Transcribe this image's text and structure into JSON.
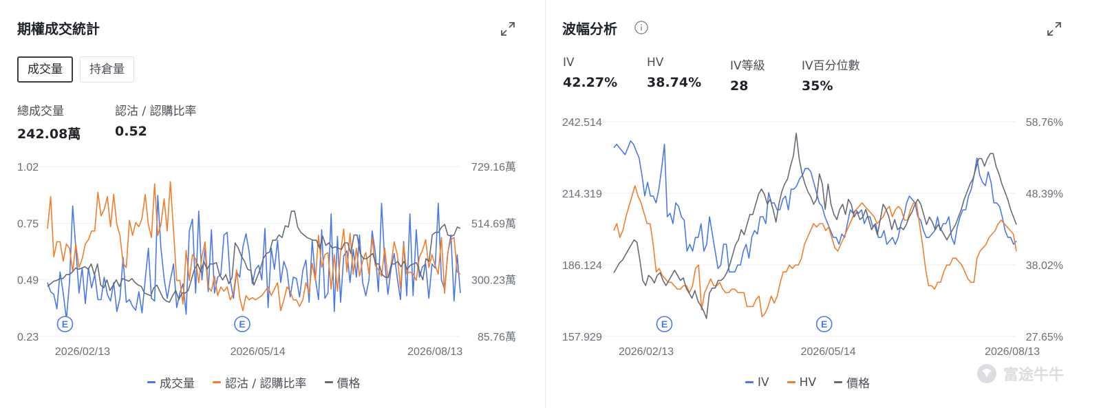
{
  "colors": {
    "blue": "#4a78e8",
    "orange": "#f07e2c",
    "gray": "#656a75"
  },
  "left": {
    "title": "期權成交統計",
    "tabs": [
      {
        "label": "成交量",
        "active": true
      },
      {
        "label": "持倉量",
        "active": false
      }
    ],
    "stats": [
      {
        "label": "總成交量",
        "value": "242.08萬"
      },
      {
        "label": "認沽 / 認購比率",
        "value": "0.52"
      }
    ],
    "legend": [
      "成交量",
      "認沽 / 認購比率",
      "價格"
    ],
    "earnings_marker": "E"
  },
  "right": {
    "title": "波幅分析",
    "stats": [
      {
        "label": "IV",
        "value": "42.27%"
      },
      {
        "label": "HV",
        "value": "38.74%"
      },
      {
        "label": "IV等級",
        "value": "28"
      },
      {
        "label": "IV百分位數",
        "value": "35%"
      }
    ],
    "legend": [
      "IV",
      "HV",
      "價格"
    ],
    "earnings_marker": "E"
  },
  "watermark": "富途牛牛",
  "chart_data": [
    {
      "type": "line",
      "x_range": [
        "2026-01-26",
        "2026-08-26"
      ],
      "x_ticks": [
        {
          "label": "2026/02/13",
          "date": "2026-02-13"
        },
        {
          "label": "2026/05/14",
          "date": "2026-05-14"
        },
        {
          "label": "2026/08/13",
          "date": "2026-08-13"
        }
      ],
      "y_left": {
        "ticks": [
          "1.02",
          "0.75",
          "0.49",
          "0.23"
        ],
        "range": [
          0.23,
          1.02
        ]
      },
      "y_right": {
        "ticks": [
          "729.16萬",
          "514.69萬",
          "300.23萬",
          "85.76萬"
        ],
        "range": [
          85.76,
          729.16
        ],
        "unit": "萬"
      },
      "earnings_dates": [
        "2026-02-04",
        "2026-05-06"
      ],
      "series": [
        {
          "name": "成交量",
          "axis": "right",
          "color": "#4a78e8",
          "values": [
            290,
            255,
            245,
            190,
            330,
            250,
            150,
            295,
            580,
            420,
            250,
            345,
            210,
            345,
            270,
            320,
            225,
            225,
            310,
            245,
            220,
            290,
            180,
            230,
            385,
            215,
            225,
            200,
            185,
            255,
            175,
            300,
            420,
            230,
            220,
            620,
            420,
            305,
            230,
            300,
            360,
            195,
            250,
            285,
            170,
            485,
            530,
            250,
            560,
            300,
            420,
            255,
            490,
            250,
            310,
            320,
            470,
            480,
            300,
            230,
            330,
            310,
            425,
            475,
            405,
            285,
            340,
            355,
            300,
            495,
            195,
            420,
            340,
            450,
            290,
            370,
            335,
            235,
            310,
            305,
            235,
            335,
            375,
            215,
            450,
            305,
            225,
            490,
            230,
            250,
            550,
            180,
            465,
            215,
            390,
            410,
            290,
            415,
            310,
            470,
            290,
            240,
            300,
            485,
            405,
            255,
            590,
            370,
            245,
            340,
            400,
            305,
            225,
            445,
            240,
            550,
            240,
            490,
            310,
            350,
            360,
            230,
            360,
            345,
            590,
            300,
            265,
            400,
            470,
            220,
            395,
            250
          ]
        },
        {
          "name": "認沽 / 認購比率",
          "axis": "left",
          "color": "#f07e2c",
          "values": [
            0.73,
            0.88,
            0.6,
            0.67,
            0.67,
            0.58,
            0.66,
            0.64,
            0.53,
            0.66,
            0.55,
            0.59,
            0.66,
            0.68,
            0.72,
            0.72,
            0.9,
            0.79,
            0.82,
            0.88,
            0.74,
            0.89,
            0.75,
            0.7,
            0.57,
            0.55,
            0.77,
            0.7,
            0.76,
            0.74,
            0.78,
            0.89,
            0.75,
            0.69,
            0.94,
            0.7,
            0.75,
            0.87,
            0.72,
            0.95,
            0.72,
            0.49,
            0.49,
            0.38,
            0.63,
            0.49,
            0.61,
            0.59,
            0.48,
            0.6,
            0.67,
            0.46,
            0.44,
            0.51,
            0.42,
            0.46,
            0.44,
            0.46,
            0.4,
            0.43,
            0.54,
            0.41,
            0.35,
            0.42,
            0.4,
            0.41,
            0.4,
            0.41,
            0.42,
            0.44,
            0.46,
            0.42,
            0.45,
            0.48,
            0.35,
            0.4,
            0.46,
            0.44,
            0.4,
            0.4,
            0.37,
            0.4,
            0.48,
            0.43,
            0.57,
            0.49,
            0.7,
            0.55,
            0.61,
            0.62,
            0.45,
            0.61,
            0.44,
            0.62,
            0.73,
            0.53,
            0.71,
            0.52,
            0.64,
            0.51,
            0.58,
            0.62,
            0.52,
            0.69,
            0.56,
            0.54,
            0.51,
            0.64,
            0.5,
            0.56,
            0.67,
            0.61,
            0.45,
            0.66,
            0.52,
            0.53,
            0.52,
            0.49,
            0.6,
            0.63,
            0.68,
            0.55,
            0.61,
            0.56,
            0.52,
            0.69,
            0.43,
            0.62,
            0.68,
            0.69,
            0.53,
            0.52
          ]
        },
        {
          "name": "價格",
          "axis": "right",
          "color": "#656a75",
          "values": [
            275,
            285,
            295,
            298,
            305,
            305,
            320,
            320,
            330,
            345,
            340,
            345,
            350,
            340,
            360,
            320,
            360,
            280,
            270,
            300,
            260,
            280,
            300,
            275,
            305,
            300,
            295,
            305,
            290,
            280,
            275,
            250,
            245,
            240,
            270,
            280,
            255,
            230,
            220,
            215,
            240,
            260,
            225,
            250,
            250,
            260,
            300,
            340,
            360,
            330,
            370,
            340,
            360,
            360,
            365,
            320,
            300,
            320,
            285,
            310,
            440,
            420,
            390,
            370,
            340,
            335,
            280,
            310,
            340,
            380,
            400,
            405,
            450,
            450,
            470,
            460,
            505,
            500,
            560,
            560,
            500,
            480,
            470,
            460,
            455,
            450,
            450,
            420,
            465,
            430,
            440,
            420,
            425,
            420,
            415,
            440,
            440,
            400,
            470,
            470,
            400,
            380,
            380,
            390,
            400,
            360,
            360,
            320,
            310,
            310,
            360,
            360,
            370,
            350,
            370,
            340,
            355,
            360,
            365,
            330,
            300,
            380,
            370,
            470,
            480,
            480,
            500,
            510,
            470,
            465,
            470,
            500,
            495
          ]
        }
      ]
    },
    {
      "type": "line",
      "x_range": [
        "2026-01-28",
        "2026-08-15"
      ],
      "x_ticks": [
        {
          "label": "2026/02/13",
          "date": "2026-02-13"
        },
        {
          "label": "2026/05/14",
          "date": "2026-05-14"
        },
        {
          "label": "2026/08/13",
          "date": "2026-08-13"
        }
      ],
      "y_left": {
        "ticks": [
          "242.514",
          "214.319",
          "186.124",
          "157.929"
        ],
        "range": [
          157.929,
          242.514
        ]
      },
      "y_right": {
        "ticks": [
          "58.76%",
          "48.39%",
          "38.02%",
          "27.65%"
        ],
        "range": [
          27.65,
          58.76
        ],
        "unit": "%"
      },
      "earnings_dates": [
        "2026-02-22",
        "2026-05-12"
      ],
      "series": [
        {
          "name": "IV",
          "axis": "right",
          "color": "#4a78e8",
          "values": [
            55.0,
            55.5,
            55.0,
            54.5,
            54.0,
            55.0,
            56.0,
            55.5,
            54.5,
            53.5,
            51.0,
            48.0,
            50.0,
            48.0,
            48.0,
            47.0,
            49.0,
            52.0,
            55.5,
            45.0,
            45.5,
            44.0,
            47.0,
            46.5,
            45.0,
            44.5,
            40.0,
            41.0,
            40.0,
            42.0,
            42.0,
            44.0,
            40.0,
            41.0,
            45.0,
            42.5,
            40.0,
            37.5,
            38.0,
            41.0,
            41.0,
            37.0,
            37.0,
            37.0,
            38.0,
            38.0,
            40.0,
            41.0,
            39.0,
            42.0,
            43.0,
            42.5,
            45.0,
            45.0,
            44.0,
            48.5,
            47.0,
            47.0,
            46.0,
            46.0,
            47.5,
            48.0,
            46.0,
            49.0,
            49.0,
            49.5,
            50.5,
            51.0,
            52.0,
            52.0,
            51.5,
            50.0,
            48.5,
            47.0,
            46.5,
            45.0,
            44.0,
            43.0,
            42.0,
            42.0,
            41.0,
            42.5,
            42.0,
            44.0,
            46.0,
            45.5,
            46.0,
            45.5,
            46.0,
            44.0,
            45.0,
            45.0,
            43.5,
            44.0,
            42.0,
            42.0,
            43.0,
            41.0,
            41.5,
            42.0,
            41.0,
            42.0,
            44.0,
            45.0,
            47.0,
            48.0,
            47.5,
            47.0,
            45.0,
            44.5,
            43.0,
            42.0,
            42.0,
            42.5,
            43.0,
            45.0,
            43.0,
            44.0,
            44.0,
            45.0,
            42.0,
            41.0,
            43.5,
            45.0,
            46.0,
            46.0,
            48.0,
            49.0,
            51.0,
            53.5,
            51.0,
            50.0,
            49.5,
            51.5,
            50.0,
            47.0,
            47.0,
            46.5,
            45.0,
            43.0,
            42.0,
            42.0,
            41.0,
            41.5
          ]
        },
        {
          "name": "HV",
          "axis": "right",
          "color": "#f07e2c",
          "values": [
            43.0,
            44.0,
            42.0,
            43.0,
            45.0,
            46.5,
            48.0,
            49.5,
            48.0,
            47.0,
            45.5,
            44.0,
            44.0,
            41.0,
            37.0,
            37.5,
            36.5,
            36.0,
            35.5,
            35.5,
            35.0,
            34.5,
            34.5,
            35.0,
            35.0,
            34.0,
            35.0,
            37.5,
            38.0,
            31.5,
            34.0,
            35.0,
            36.0,
            35.0,
            35.0,
            35.5,
            34.5,
            34.0,
            34.0,
            34.5,
            34.5,
            34.0,
            34.0,
            34.0,
            32.0,
            32.0,
            32.0,
            33.0,
            33.5,
            30.5,
            31.0,
            32.0,
            33.5,
            32.5,
            33.5,
            35.5,
            37.0,
            37.0,
            38.0,
            37.5,
            38.0,
            38.0,
            39.0,
            41.0,
            42.0,
            43.0,
            44.0,
            43.5,
            44.0,
            44.0,
            43.0,
            43.5,
            42.0,
            40.5,
            40.0,
            41.0,
            42.0,
            43.0,
            44.0,
            45.0,
            46.0,
            46.5,
            47.0,
            46.5,
            46.0,
            45.5,
            45.0,
            44.0,
            44.5,
            45.0,
            46.0,
            46.5,
            45.0,
            46.0,
            46.5,
            46.0,
            44.5,
            44.5,
            46.0,
            47.0,
            47.0,
            44.0,
            41.0,
            37.5,
            35.0,
            35.0,
            34.5,
            35.5,
            35.5,
            37.0,
            38.0,
            38.0,
            39.0,
            39.0,
            38.5,
            38.0,
            37.0,
            36.0,
            35.5,
            35.5,
            39.0,
            40.0,
            40.5,
            41.0,
            42.0,
            42.5,
            43.0,
            44.0,
            44.5,
            44.0,
            43.5,
            43.0,
            42.5,
            40.0
          ]
        },
        {
          "name": "價格",
          "axis": "left",
          "color": "#656a75",
          "values": [
            183.0,
            185.0,
            187.0,
            188.0,
            190.0,
            192.0,
            194.0,
            196.0,
            195.0,
            188.0,
            180.0,
            178.0,
            182.0,
            181.0,
            179.0,
            182.0,
            183.0,
            180.0,
            178.0,
            180.0,
            182.0,
            184.0,
            182.0,
            180.0,
            181.0,
            177.0,
            175.0,
            173.0,
            176.0,
            172.0,
            170.0,
            168.0,
            165.0,
            175.0,
            177.0,
            177.0,
            180.0,
            180.0,
            181.0,
            183.0,
            186.0,
            190.0,
            194.0,
            196.0,
            200.0,
            198.0,
            202.0,
            206.0,
            206.0,
            210.0,
            214.0,
            216.0,
            214.0,
            210.0,
            212.0,
            208.0,
            203.0,
            210.0,
            215.0,
            218.0,
            220.0,
            225.0,
            229.0,
            238.0,
            228.0,
            222.0,
            218.0,
            215.0,
            213.0,
            210.0,
            212.0,
            222.0,
            218.0,
            208.0,
            218.0,
            210.0,
            206.0,
            204.0,
            208.0,
            210.0,
            206.0,
            212.0,
            210.0,
            205.0,
            207.0,
            204.0,
            205.0,
            208.0,
            204.0,
            200.0,
            202.0,
            198.0,
            204.0,
            210.0,
            208.0,
            205.0,
            200.0,
            204.0,
            200.0,
            201.0,
            200.0,
            202.0,
            205.0,
            207.0,
            210.0,
            212.0,
            210.0,
            206.0,
            202.0,
            205.0,
            203.0,
            200.0,
            202.0,
            200.0,
            198.0,
            196.0,
            198.0,
            200.0,
            202.0,
            205.0,
            208.0,
            212.0,
            215.0,
            218.0,
            220.0,
            224.0,
            228.0,
            228.0,
            225.0,
            228.0,
            230.0,
            230.0,
            225.0,
            222.0,
            218.0,
            215.0,
            212.0,
            208.0,
            205.0,
            202.0
          ]
        }
      ]
    }
  ]
}
